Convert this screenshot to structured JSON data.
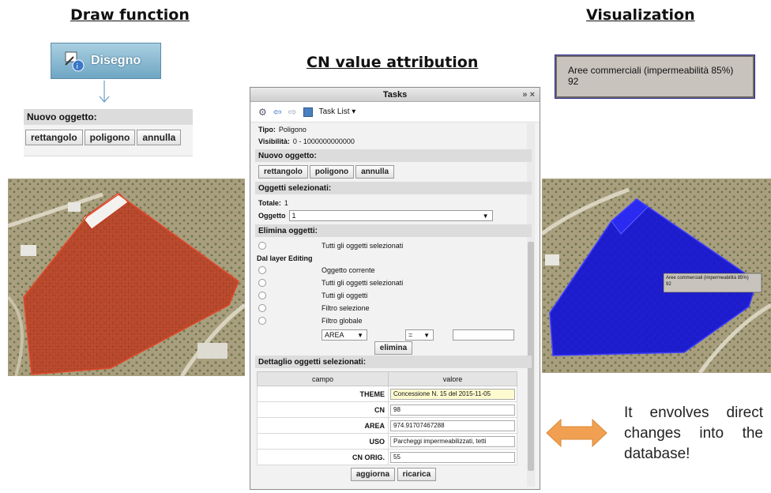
{
  "headings": {
    "draw": "Draw function",
    "cn": "CN value attribution",
    "vis": "Visualization"
  },
  "disegno_button": {
    "label": "Disegno"
  },
  "draw_box": {
    "header": "Nuovo oggetto:",
    "buttons": [
      "rettangolo",
      "poligono",
      "annulla"
    ]
  },
  "tasks_panel": {
    "title": "Tasks",
    "title_controls": "» ×",
    "task_list_label": "Task List",
    "tipo_label": "Tipo:",
    "tipo_value": "Poligono",
    "visibilita_label": "Visibilità:",
    "visibilita_value": "0 - 1000000000000",
    "nuovo_header": "Nuovo oggetto:",
    "nuovo_buttons": [
      "rettangolo",
      "poligono",
      "annulla"
    ],
    "selezionati_header": "Oggetti selezionati:",
    "totale_label": "Totale:",
    "totale_value": "1",
    "oggetto_label": "Oggetto",
    "oggetto_value": "1",
    "elimina_header": "Elimina oggetti:",
    "elimina_options": [
      "Tutti gli oggetti selezionati"
    ],
    "dal_layer_label": "Dal layer Editing",
    "layer_options": [
      "Oggetto corrente",
      "Tutti gli oggetti selezionati",
      "Tutti gli oggetti",
      "Filtro selezione",
      "Filtro globale"
    ],
    "filter_field": "AREA",
    "filter_op": "=",
    "filter_value": "",
    "elimina_button": "elimina",
    "dettaglio_header": "Dettaglio oggetti selezionati:",
    "table_headers": [
      "campo",
      "valore"
    ],
    "rows": [
      {
        "campo": "THEME",
        "valore": "Concessione N. 15 del 2015-11-05"
      },
      {
        "campo": "CN",
        "valore": "98"
      },
      {
        "campo": "AREA",
        "valore": "974.91707467288"
      },
      {
        "campo": "USO",
        "valore": "Parcheggi impermeabilizzati, tetti"
      },
      {
        "campo": "CN ORIG.",
        "valore": "55"
      }
    ],
    "aggiorna_button": "aggiorna",
    "ricarica_button": "ricarica"
  },
  "visualization": {
    "tooltip_title": "Aree commerciali (impermeabilità 85%)",
    "tooltip_value": "92",
    "map_label_title": "Aree commerciali (impermeabilità 85%)",
    "map_label_value": "92"
  },
  "side_text": "It envolves direct changes into the database!",
  "colors": {
    "red_fill": "#c0391e",
    "blue_fill": "#1010d8",
    "arrow": "#f0a050",
    "highlight_input": "#fdfbcf"
  }
}
